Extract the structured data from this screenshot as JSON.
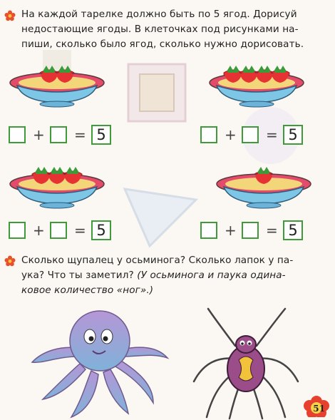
{
  "task1": {
    "lines": [
      "На каждой тарелке должно быть по 5 ягод. Дорисуй",
      "недостающие ягоды. В клеточках под рисунками на-",
      "пиши, сколько было ягод, сколько нужно дорисовать."
    ]
  },
  "equations": [
    {
      "plus": "+",
      "equals": "=",
      "total": "5"
    },
    {
      "plus": "+",
      "equals": "=",
      "total": "5"
    },
    {
      "plus": "+",
      "equals": "=",
      "total": "5"
    },
    {
      "plus": "+",
      "equals": "=",
      "total": "5"
    }
  ],
  "plates": [
    {
      "berries": 2
    },
    {
      "berries": 4
    },
    {
      "berries": 3
    },
    {
      "berries": 1
    }
  ],
  "task2": {
    "line1": "Сколько щупалец у осьминога? Сколько лапок у па-",
    "line2_normal": "ука? Что ты заметил? ",
    "line2_italic": "(У осьминога и паука одина-",
    "line3": "ковое количество «ног».)"
  },
  "page_number": "51",
  "colors": {
    "box_border": "#3f9a3a",
    "flower": "#e8502a",
    "berry": "#e63232",
    "plate_rim": "#e44a6a",
    "plate_body": "#7ec6e6",
    "octopus": "#a98bc9",
    "spider": "#9b4d8a"
  }
}
